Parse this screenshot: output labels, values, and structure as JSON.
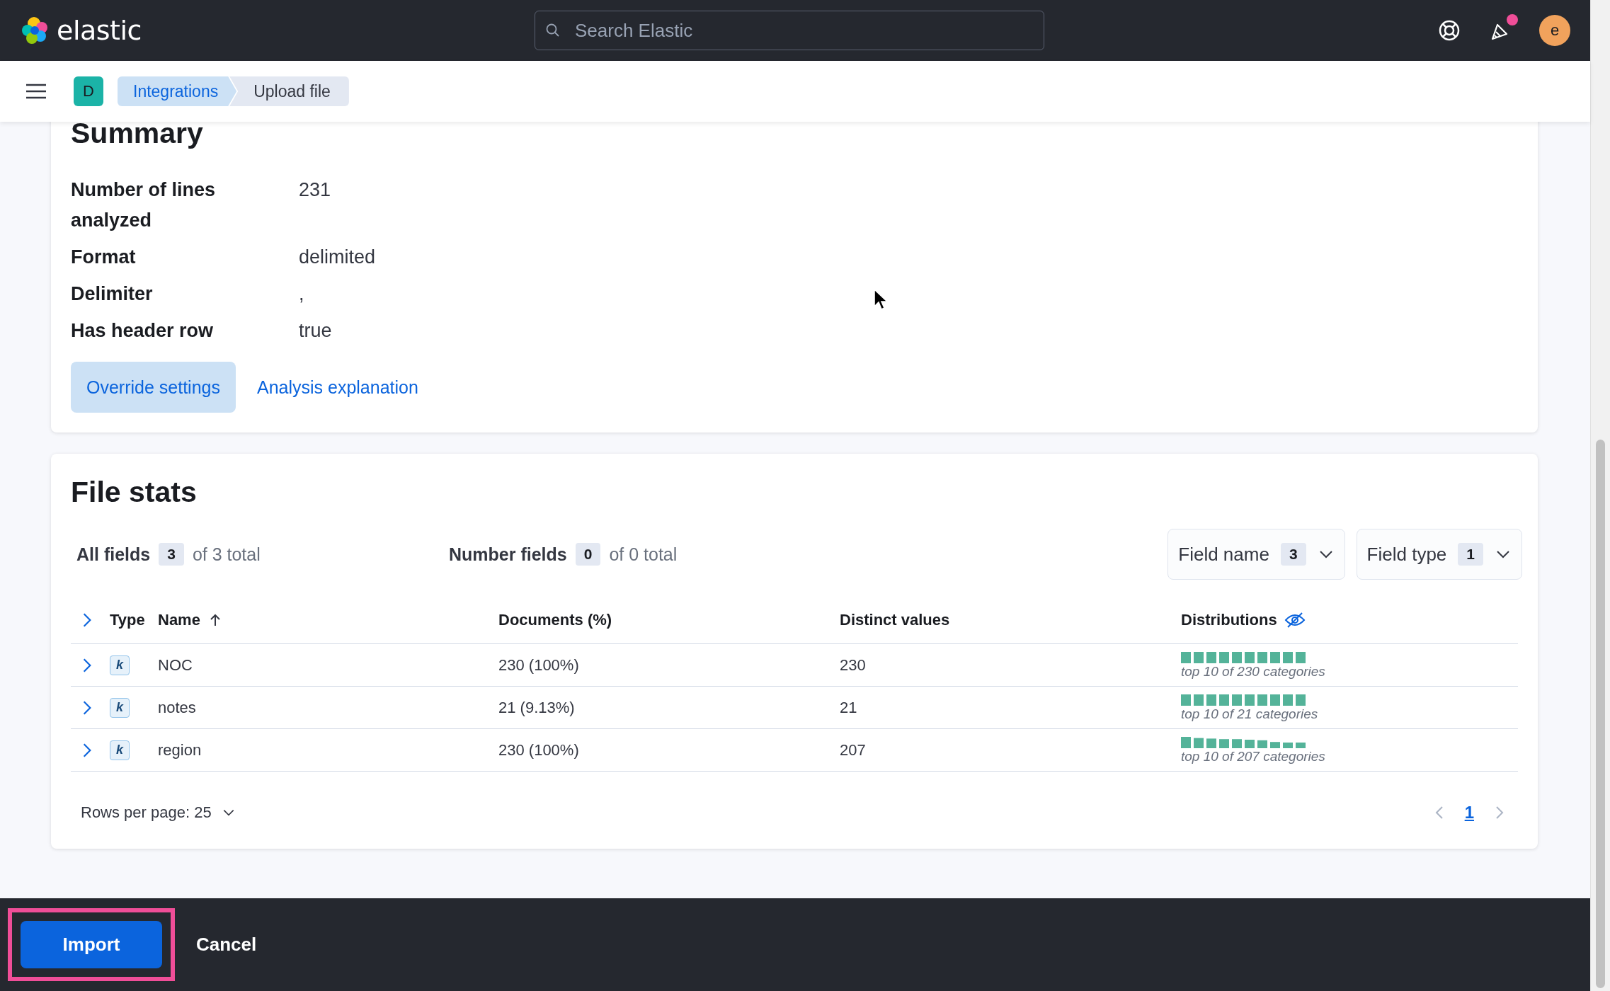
{
  "header": {
    "brand": "elastic",
    "search": {
      "placeholder": "Search Elastic"
    },
    "notification_unread": true,
    "avatar": "e"
  },
  "subheader": {
    "space": "D",
    "breadcrumbs": [
      {
        "label": "Integrations",
        "current": false
      },
      {
        "label": "Upload file",
        "current": true
      }
    ]
  },
  "summary": {
    "title": "Summary",
    "items": [
      {
        "label": "Number of lines analyzed",
        "value": "231"
      },
      {
        "label": "Format",
        "value": "delimited"
      },
      {
        "label": "Delimiter",
        "value": ","
      },
      {
        "label": "Has header row",
        "value": "true"
      }
    ],
    "buttons": [
      {
        "label": "Override settings",
        "kind": "filled"
      },
      {
        "label": "Analysis explanation",
        "kind": "link"
      }
    ]
  },
  "file_stats": {
    "title": "File stats",
    "counts": [
      {
        "label": "All fields",
        "count": "3",
        "total": "of 3 total"
      },
      {
        "label": "Number fields",
        "count": "0",
        "total": "of 0 total"
      }
    ],
    "filters": [
      {
        "label": "Field name",
        "count": "3"
      },
      {
        "label": "Field type",
        "count": "1"
      }
    ],
    "table": {
      "columns": [
        "Type",
        "Name",
        "Documents (%)",
        "Distinct values",
        "Distributions"
      ],
      "rows": [
        {
          "type": "k",
          "name": "NOC",
          "documents": "230 (100%)",
          "distinct": "230",
          "kind": "uniform",
          "caption": "top 10 of 230 categories"
        },
        {
          "type": "k",
          "name": "notes",
          "documents": "21 (9.13%)",
          "distinct": "21",
          "kind": "uniform",
          "caption": "top 10 of 21 categories"
        },
        {
          "type": "k",
          "name": "region",
          "documents": "230 (100%)",
          "distinct": "207",
          "kind": "skewed",
          "caption": "top 10 of 207 categories"
        }
      ]
    },
    "rows_per_page": "Rows per page: 25",
    "pages": [
      {
        "label": "1",
        "selected": true
      }
    ]
  },
  "bottom_bar": {
    "buttons": [
      {
        "label": "Import",
        "kind": "primary",
        "highlighted": true
      },
      {
        "label": "Cancel",
        "kind": "text",
        "highlighted": false
      }
    ]
  }
}
